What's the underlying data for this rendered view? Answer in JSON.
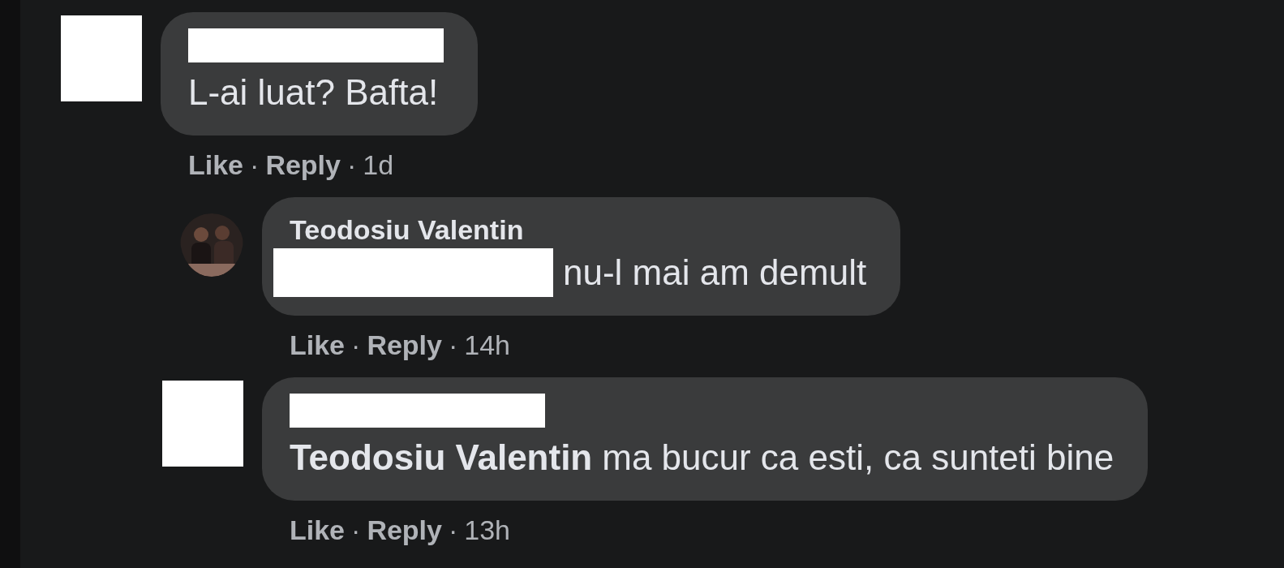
{
  "comments": [
    {
      "avatar": {
        "kind": "redacted"
      },
      "author": {
        "kind": "redacted"
      },
      "body": [
        {
          "kind": "text",
          "text": "L-ai luat? Bafta!"
        }
      ],
      "actions": [
        {
          "kind": "link",
          "text": "Like"
        },
        {
          "kind": "separator",
          "text": "·"
        },
        {
          "kind": "link",
          "text": "Reply"
        },
        {
          "kind": "separator",
          "text": "·"
        },
        {
          "kind": "time",
          "text": "1d"
        }
      ],
      "children": [
        {
          "avatar": {
            "kind": "photo"
          },
          "author": {
            "kind": "name",
            "text": "Teodosiu Valentin"
          },
          "body": [
            {
              "kind": "redacted"
            },
            {
              "kind": "text",
              "text": "nu-l mai am demult"
            }
          ],
          "actions": [
            {
              "kind": "link",
              "text": "Like"
            },
            {
              "kind": "separator",
              "text": "·"
            },
            {
              "kind": "link",
              "text": "Reply"
            },
            {
              "kind": "separator",
              "text": "·"
            },
            {
              "kind": "time",
              "text": "14h"
            }
          ]
        },
        {
          "avatar": {
            "kind": "redacted"
          },
          "author": {
            "kind": "redacted"
          },
          "body": [
            {
              "kind": "mention",
              "text": "Teodosiu Valentin"
            },
            {
              "kind": "text",
              "text": "ma bucur ca esti, ca sunteti bine"
            }
          ],
          "actions": [
            {
              "kind": "link",
              "text": "Like"
            },
            {
              "kind": "separator",
              "text": "·"
            },
            {
              "kind": "link",
              "text": "Reply"
            },
            {
              "kind": "separator",
              "text": "·"
            },
            {
              "kind": "time",
              "text": "13h"
            }
          ]
        }
      ]
    }
  ]
}
